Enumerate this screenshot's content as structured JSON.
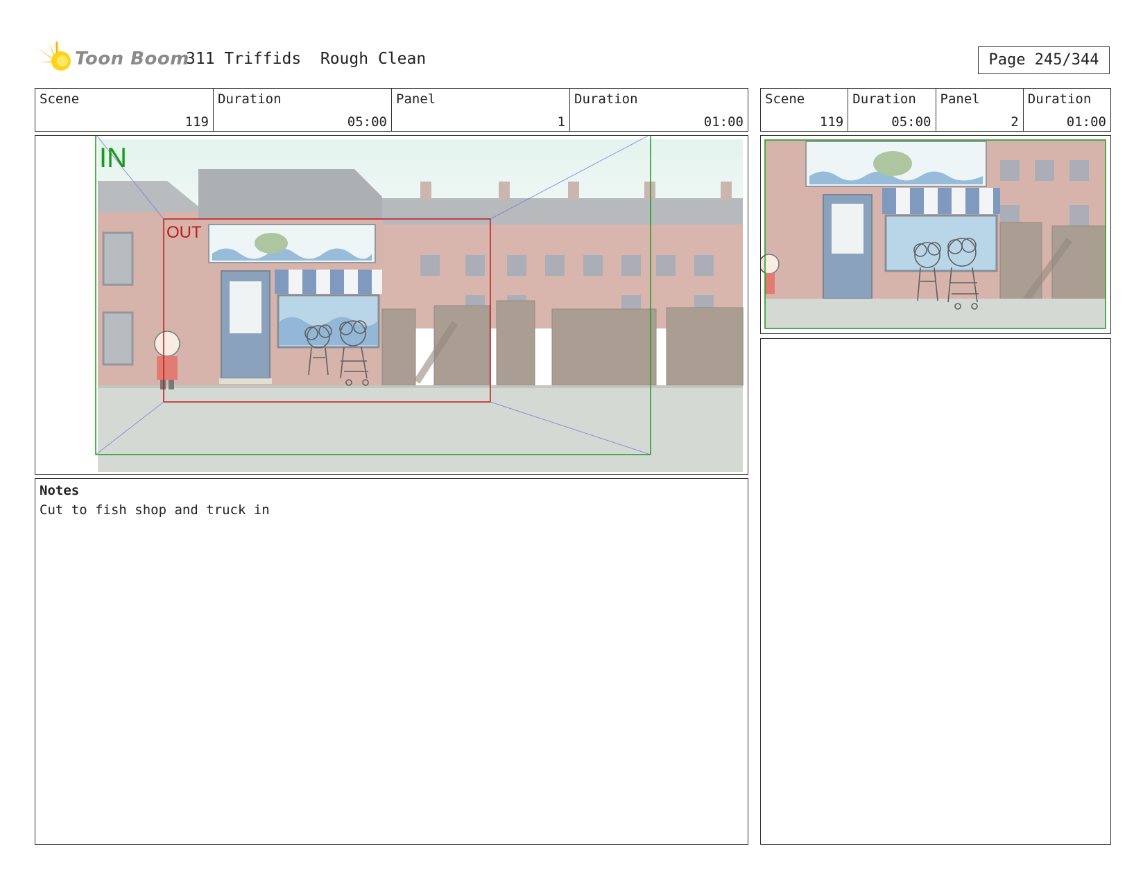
{
  "header": {
    "logo_text": "Toon Boom",
    "project_title": "311 Triffids  Rough Clean",
    "page_label": "Page 245/344"
  },
  "main_panel_info": {
    "scene_label": "Scene",
    "scene_value": "119",
    "duration_label": "Duration",
    "duration_value": "05:00",
    "panel_label": "Panel",
    "panel_value": "1",
    "panel_duration_label": "Duration",
    "panel_duration_value": "01:00"
  },
  "side_panel_info": {
    "scene_label": "Scene",
    "scene_value": "119",
    "duration_label": "Duration",
    "duration_value": "05:00",
    "panel_label": "Panel",
    "panel_value": "2",
    "panel_duration_label": "Duration",
    "panel_duration_value": "01:00"
  },
  "camera": {
    "in_label": "IN",
    "out_label": "OUT",
    "in_color": "#1a9a1a",
    "out_color": "#c01818"
  },
  "notes": {
    "title": "Notes",
    "text": "Cut to fish shop and truck in"
  }
}
